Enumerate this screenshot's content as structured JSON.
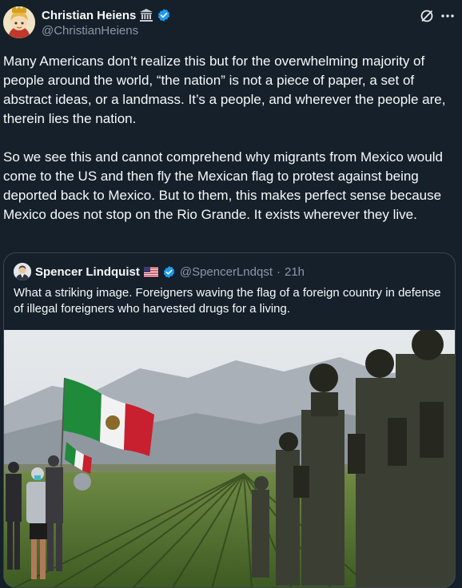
{
  "author": {
    "display_name": "Christian Heiens",
    "handle": "@ChristianHeiens",
    "badges": [
      "classical-building-icon",
      "verified-badge-icon"
    ]
  },
  "header_actions": [
    "grok-icon",
    "more-icon"
  ],
  "body": {
    "paragraphs": [
      "Many Americans don’t realize this but for the overwhelming majority of people around the world, “the nation” is not a piece of paper, a set of abstract ideas, or a landmass. It’s a people, and wherever the people are, therein lies the nation.",
      "So we see this and cannot comprehend why migrants from Mexico would come to the US and then fly the Mexican flag to protest against being deported back to Mexico. But to them, this makes perfect sense because Mexico does not stop on the Rio Grande. It exists wherever they live."
    ]
  },
  "quoted": {
    "display_name": "Spencer Lindquist",
    "badges": [
      "us-flag-icon",
      "verified-badge-icon"
    ],
    "handle": "@SpencerLndqst",
    "separator": "·",
    "time": "21h",
    "text": "What a striking image. Foreigners waving the flag of a foreign country in defense of illegal foreigners who harvested drugs for a living.",
    "media": "photo of protesters with Mexican flags facing armed tactical officers in a crop field, mountains in the background"
  },
  "colors": {
    "background": "#15202b",
    "text": "#f7f9f9",
    "secondary": "#8b98a5",
    "border": "#38444d",
    "verified": "#1d9bf0"
  }
}
